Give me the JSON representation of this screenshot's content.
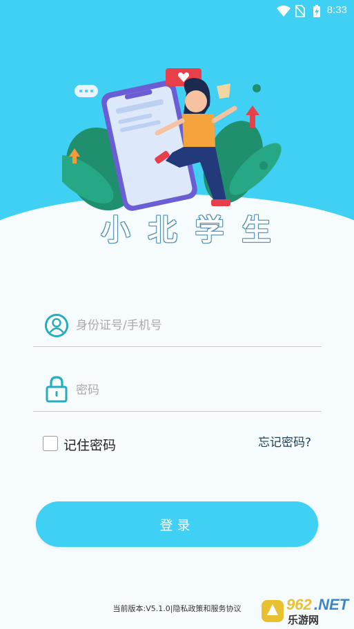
{
  "status_bar": {
    "time": "8:33",
    "icons": [
      "wifi-icon",
      "no-sim-icon",
      "battery-charging-icon"
    ]
  },
  "header": {
    "app_title": "小北学生"
  },
  "form": {
    "username_placeholder": "身份证号/手机号",
    "password_placeholder": "密码",
    "remember_label": "记住密码",
    "forgot_label": "忘记密码?",
    "login_label": "登录"
  },
  "footer": {
    "version_text": "当前版本:V5.1.0",
    "separator": "|",
    "policy_text": "隐私政策和服务协议"
  },
  "watermark": {
    "number": "962",
    "suffix": ".NET",
    "site": "乐游网"
  },
  "colors": {
    "accent": "#3fd0f3",
    "background": "#f6fbfd",
    "icon_teal": "#22aebf"
  }
}
